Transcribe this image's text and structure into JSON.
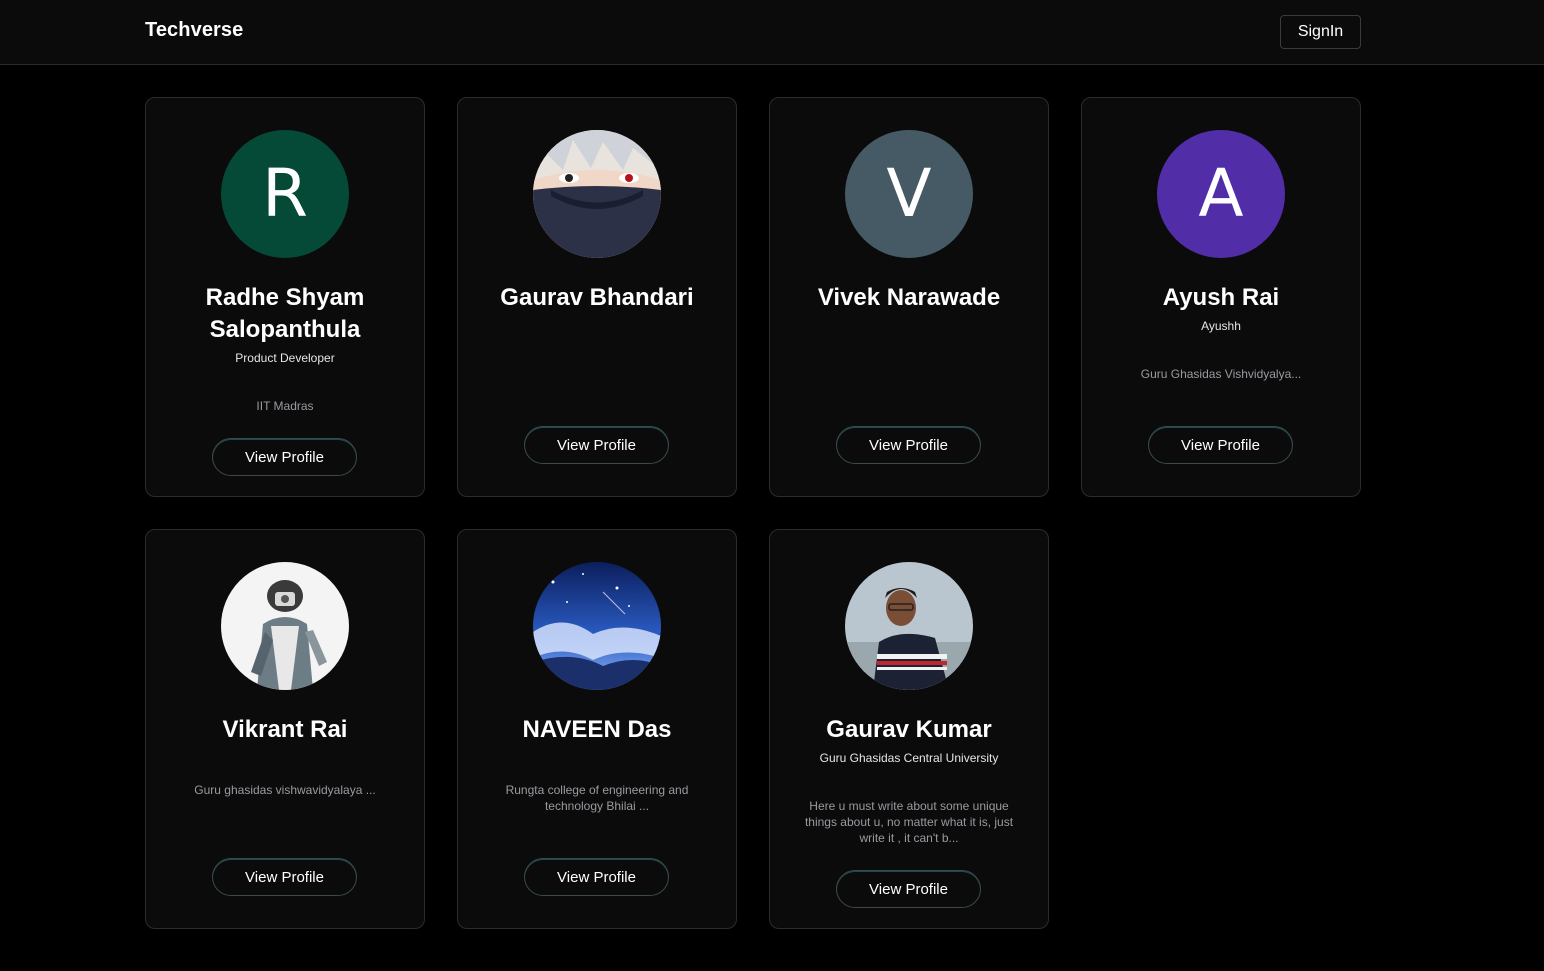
{
  "navbar": {
    "brand": "Techverse",
    "signin_label": "SignIn"
  },
  "profiles": [
    {
      "name": "Radhe Shyam Salopanthula",
      "username": "Product Developer",
      "bio": "IIT Madras",
      "avatar_initial": "R",
      "avatar_color": "#044a37",
      "button": "View Profile"
    },
    {
      "name": "Gaurav Bhandari",
      "username": "",
      "bio": "",
      "avatar_image": "masked-ninja-anime-avatar",
      "button": "View Profile"
    },
    {
      "name": "Vivek Narawade",
      "username": "",
      "bio": "",
      "avatar_initial": "V",
      "avatar_color": "#455a64",
      "button": "View Profile"
    },
    {
      "name": "Ayush Rai",
      "username": "Ayushh",
      "bio": "Guru Ghasidas Vishvidyalya...",
      "avatar_initial": "A",
      "avatar_color": "#512da8",
      "button": "View Profile"
    },
    {
      "name": "Vikrant Rai",
      "username": "",
      "bio": "Guru ghasidas vishwavidyalaya ...",
      "avatar_image": "sketch-person-with-camera",
      "button": "View Profile"
    },
    {
      "name": "NAVEEN Das",
      "username": "",
      "bio": "Rungta college of engineering and technology Bhilai ...",
      "avatar_image": "starry-night-sky",
      "button": "View Profile"
    },
    {
      "name": "Gaurav Kumar",
      "username": "Guru Ghasidas Central University",
      "bio": "Here u must write about some unique things about u, no matter what it is, just write it , it can't b...",
      "avatar_image": "man-in-striped-sweater",
      "button": "View Profile"
    }
  ]
}
